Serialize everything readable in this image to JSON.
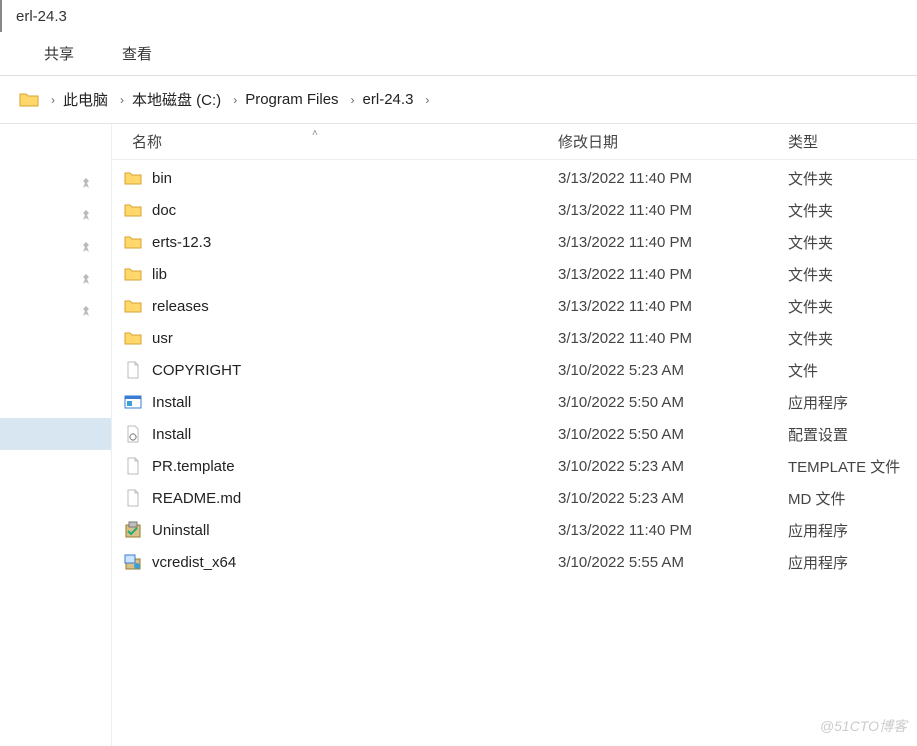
{
  "title": "erl-24.3",
  "ribbon": {
    "share": "共享",
    "view": "查看"
  },
  "breadcrumb": [
    {
      "label": "此电脑"
    },
    {
      "label": "本地磁盘 (C:)"
    },
    {
      "label": "Program Files"
    },
    {
      "label": "erl-24.3"
    }
  ],
  "columns": {
    "name": "名称",
    "modified": "修改日期",
    "type": "类型"
  },
  "rows": [
    {
      "icon": "folder",
      "name": "bin",
      "modified": "3/13/2022 11:40 PM",
      "type": "文件夹"
    },
    {
      "icon": "folder",
      "name": "doc",
      "modified": "3/13/2022 11:40 PM",
      "type": "文件夹"
    },
    {
      "icon": "folder",
      "name": "erts-12.3",
      "modified": "3/13/2022 11:40 PM",
      "type": "文件夹"
    },
    {
      "icon": "folder",
      "name": "lib",
      "modified": "3/13/2022 11:40 PM",
      "type": "文件夹"
    },
    {
      "icon": "folder",
      "name": "releases",
      "modified": "3/13/2022 11:40 PM",
      "type": "文件夹"
    },
    {
      "icon": "folder",
      "name": "usr",
      "modified": "3/13/2022 11:40 PM",
      "type": "文件夹"
    },
    {
      "icon": "file",
      "name": "COPYRIGHT",
      "modified": "3/10/2022 5:23 AM",
      "type": "文件"
    },
    {
      "icon": "exe",
      "name": "Install",
      "modified": "3/10/2022 5:50 AM",
      "type": "应用程序"
    },
    {
      "icon": "ini",
      "name": "Install",
      "modified": "3/10/2022 5:50 AM",
      "type": "配置设置"
    },
    {
      "icon": "file",
      "name": "PR.template",
      "modified": "3/10/2022 5:23 AM",
      "type": "TEMPLATE 文件"
    },
    {
      "icon": "file",
      "name": "README.md",
      "modified": "3/10/2022 5:23 AM",
      "type": "MD 文件"
    },
    {
      "icon": "uninst",
      "name": "Uninstall",
      "modified": "3/13/2022 11:40 PM",
      "type": "应用程序"
    },
    {
      "icon": "inst2",
      "name": "vcredist_x64",
      "modified": "3/10/2022 5:55 AM",
      "type": "应用程序"
    }
  ],
  "watermark": "@51CTO博客"
}
